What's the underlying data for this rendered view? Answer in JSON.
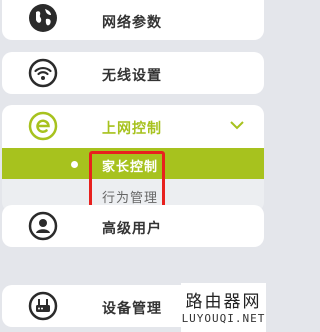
{
  "menu": {
    "network_params": "网络参数",
    "wireless_settings": "无线设置",
    "internet_control": "上网控制",
    "advanced_users": "高级用户",
    "device_management": "设备管理"
  },
  "submenu": {
    "parental_control": "家长控制",
    "behavior_management": "行为管理"
  },
  "watermark": {
    "line1": "路由器网",
    "line2": "LUYOUQI.NET"
  },
  "colors": {
    "accent": "#a7c21e",
    "highlight_box": "#e8201e",
    "icon_dark": "#2b2b2b",
    "background": "#e4e6eb"
  }
}
